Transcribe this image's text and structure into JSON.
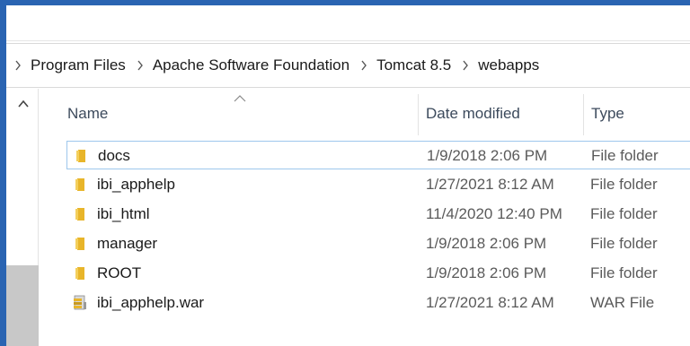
{
  "window": {
    "frame_color": "#2a64b2"
  },
  "breadcrumb": {
    "items": [
      {
        "label": "Program Files"
      },
      {
        "label": "Apache Software Foundation"
      },
      {
        "label": "Tomcat 8.5"
      },
      {
        "label": "webapps"
      }
    ],
    "separator_icon": "chevron-right-icon"
  },
  "file_list": {
    "columns": {
      "name": "Name",
      "date_modified": "Date modified",
      "type": "Type"
    },
    "sort_icon": "sort-ascending-icon",
    "rows": [
      {
        "name": "docs",
        "date": "1/9/2018 2:06 PM",
        "type": "File folder",
        "icon": "folder-icon",
        "selected": true
      },
      {
        "name": "ibi_apphelp",
        "date": "1/27/2021 8:12 AM",
        "type": "File folder",
        "icon": "folder-icon"
      },
      {
        "name": "ibi_html",
        "date": "11/4/2020 12:40 PM",
        "type": "File folder",
        "icon": "folder-icon"
      },
      {
        "name": "manager",
        "date": "1/9/2018 2:06 PM",
        "type": "File folder",
        "icon": "folder-icon"
      },
      {
        "name": "ROOT",
        "date": "1/9/2018 2:06 PM",
        "type": "File folder",
        "icon": "folder-icon"
      },
      {
        "name": "ibi_apphelp.war",
        "date": "1/27/2021 8:12 AM",
        "type": "WAR File",
        "icon": "archive-file-icon"
      }
    ]
  },
  "colors": {
    "folder": "#e8b52a",
    "selection_border": "#9ec7ec",
    "header_text": "#3c4a5c"
  }
}
